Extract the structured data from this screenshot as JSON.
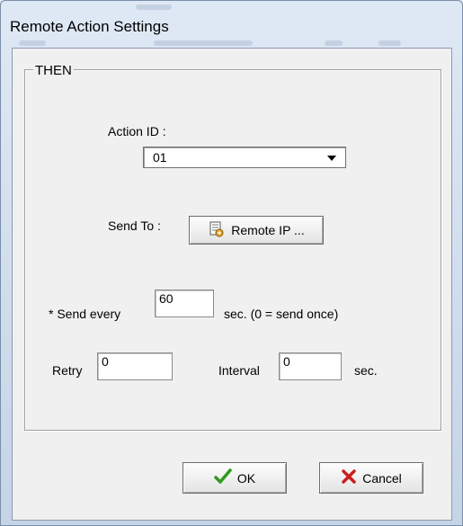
{
  "window": {
    "title": "Remote Action Settings"
  },
  "group": {
    "title": "THEN"
  },
  "action": {
    "label": "Action ID :",
    "selected": "01"
  },
  "send_to": {
    "label": "Send To :",
    "button_label": "Remote IP ..."
  },
  "send_every": {
    "prefix": "* Send every",
    "value": "60",
    "suffix": "sec. (0 = send once)"
  },
  "retry": {
    "label": "Retry",
    "value": "0"
  },
  "interval": {
    "label": "Interval",
    "value": "0",
    "unit": "sec."
  },
  "buttons": {
    "ok": "OK",
    "cancel": "Cancel"
  },
  "icons": {
    "remote_ip": "document-gear-icon",
    "ok": "checkmark-icon",
    "cancel": "x-mark-icon"
  },
  "colors": {
    "ok_check": "#2f9a1e",
    "cancel_x": "#c81e1e"
  }
}
